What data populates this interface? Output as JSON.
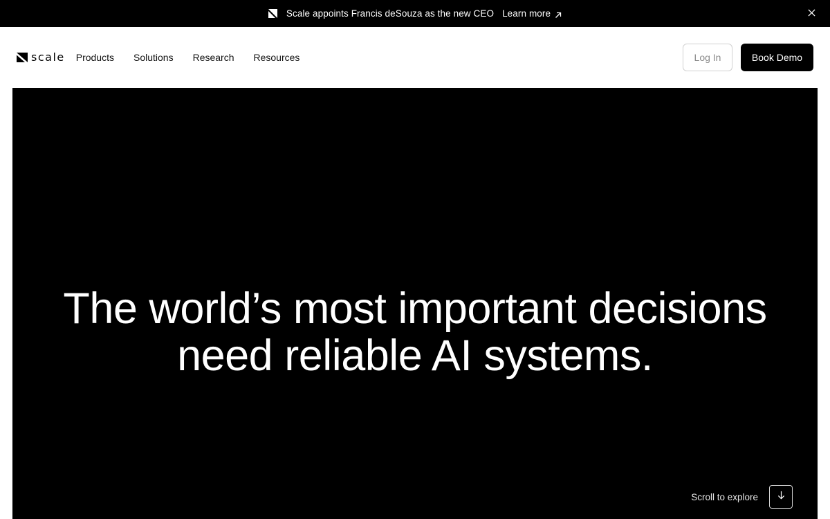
{
  "announcement": {
    "message": "Scale appoints Francis deSouza as the new CEO",
    "link_label": "Learn more",
    "icons": {
      "logo": "scale-logo-icon",
      "link": "arrow-up-right-icon",
      "close": "close-icon"
    }
  },
  "nav": {
    "brand": "scale",
    "menu": [
      {
        "label": "Products"
      },
      {
        "label": "Solutions"
      },
      {
        "label": "Research"
      },
      {
        "label": "Resources"
      }
    ],
    "login_label": "Log In",
    "demo_label": "Book Demo"
  },
  "hero": {
    "headline_line1": "The world’s most important decisions",
    "headline_line2": "need reliable AI systems.",
    "scroll_label": "Scroll to explore",
    "scroll_icon": "arrow-down-icon"
  },
  "colors": {
    "background": "#000000",
    "foreground": "#ffffff",
    "page": "#ffffff",
    "login_text": "#8a8a8a",
    "login_border": "#d0d0d0"
  }
}
